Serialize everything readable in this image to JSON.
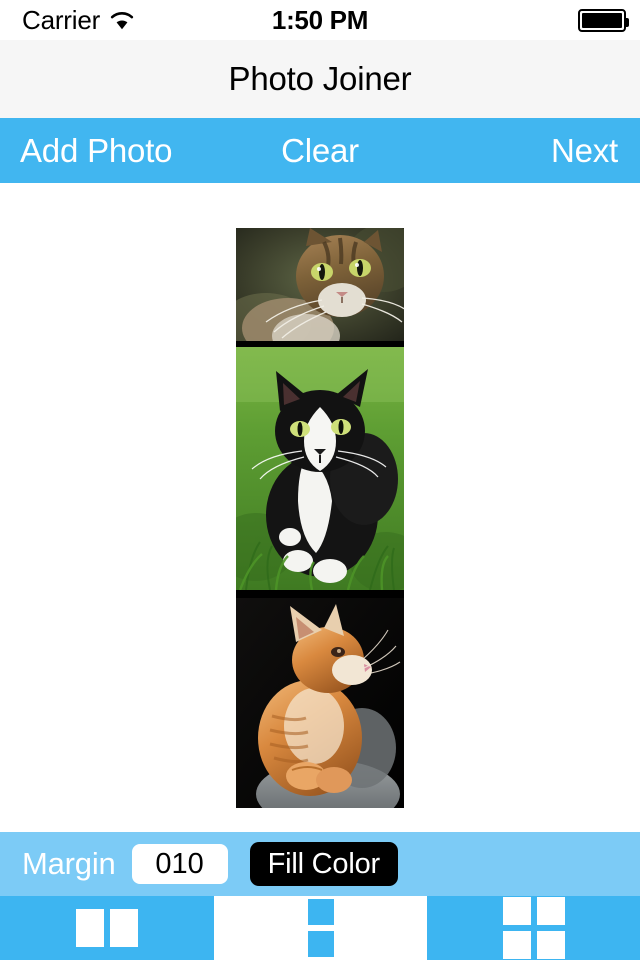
{
  "status_bar": {
    "carrier": "Carrier",
    "wifi_icon": "wifi-icon",
    "time": "1:50 PM",
    "battery_icon": "battery-full-icon"
  },
  "nav_bar": {
    "title": "Photo Joiner"
  },
  "action_bar": {
    "add_photo_label": "Add Photo",
    "clear_label": "Clear",
    "next_label": "Next",
    "background_color": "#41b6f0",
    "text_color": "#ffffff"
  },
  "canvas": {
    "fill_color": "#000000",
    "layout": "vertical",
    "photos": [
      {
        "index": 1,
        "description": "Close-up of a brown tabby cat with green eyes and long white whiskers, blurred dark green foliage background",
        "alt": "tabby-cat-closeup"
      },
      {
        "index": 2,
        "description": "Black and white tuxedo cat sitting upright on bright green grass, facing camera",
        "alt": "tuxedo-cat-in-grass"
      },
      {
        "index": 3,
        "description": "Ginger orange tabby cat lying on a grey cushion looking upward, dark black background",
        "alt": "ginger-cat-looking-up"
      }
    ]
  },
  "margin_bar": {
    "label": "Margin",
    "margin_value": "010",
    "margin_placeholder": "010",
    "fill_color_label": "Fill Color",
    "background_color": "#7ccbf6",
    "fill_button_color": "#000000"
  },
  "tab_bar": {
    "background_color": "#3db5f1",
    "selected_background": "#ffffff",
    "tabs": [
      {
        "id": "horizontal",
        "icon": "layout-horizontal-icon",
        "selected": false
      },
      {
        "id": "vertical",
        "icon": "layout-vertical-icon",
        "selected": true
      },
      {
        "id": "grid",
        "icon": "layout-grid-icon",
        "selected": false
      }
    ]
  }
}
